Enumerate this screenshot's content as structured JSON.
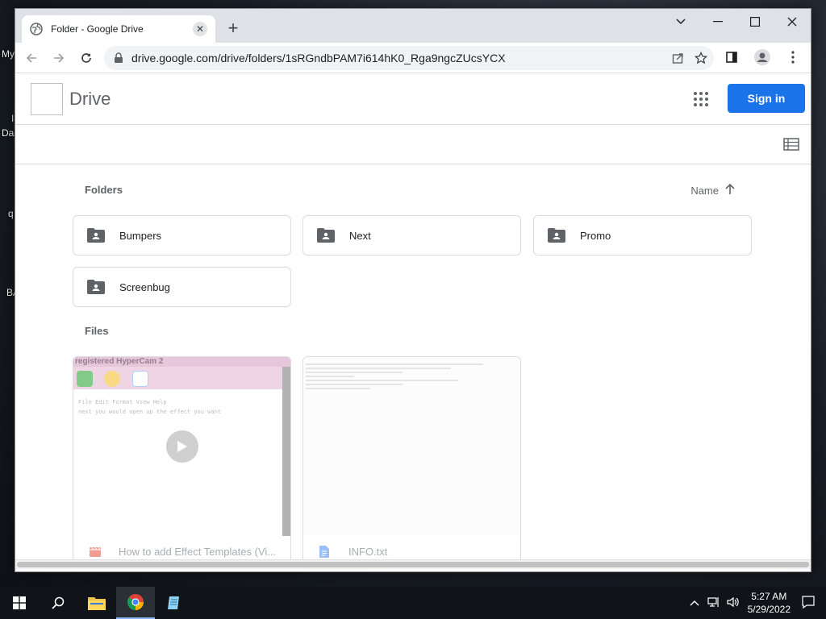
{
  "desktop": {
    "fragments": [
      "My",
      "I",
      "Da",
      "q",
      "BA"
    ]
  },
  "browser": {
    "tab_title": "Folder - Google Drive",
    "url": "drive.google.com/drive/folders/1sRGndbPAM7i614hK0_Rga9ngcZUcsYCX"
  },
  "drive": {
    "app_title": "Drive",
    "signin_label": "Sign in",
    "folders_label": "Folders",
    "sort_label": "Name",
    "files_label": "Files",
    "folders": [
      {
        "name": "Bumpers"
      },
      {
        "name": "Next"
      },
      {
        "name": "Promo"
      },
      {
        "name": "Screenbug"
      }
    ],
    "files": [
      {
        "name": "How to add Effect Templates (Vi...",
        "thumb_header": "registered HyperCam 2",
        "thumb_menu": "File  Edit  Format  View  Help",
        "thumb_text": "next you would open up the effect you want"
      },
      {
        "name": "INFO.txt"
      }
    ]
  },
  "taskbar": {
    "time": "5:27 AM",
    "date": "5/29/2022"
  },
  "colors": {
    "accent": "#1a73e8",
    "folder_icon": "#5f6368"
  }
}
